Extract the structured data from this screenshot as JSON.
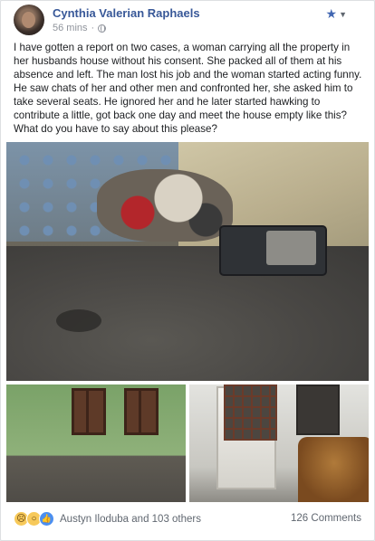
{
  "post": {
    "author": "Cynthia Valerian Raphaels",
    "time": "56 mins",
    "separator": "·",
    "body": "I have gotten a report on two cases, a woman carrying all the property in her husbands house without his consent. She packed all of them at his absence and left. The man lost his job and the woman started acting funny. He saw chats of her and other men and confronted her, she asked him to take several seats. He ignored her and he later started hawking to contribute a little, got back one day and meet the house empty like this? What do you have to say about this please?"
  },
  "actions": {
    "star_icon": "star-icon",
    "chevron_icon": "chevron-down-icon"
  },
  "photos": [
    {
      "name": "room-with-suitcase-photo"
    },
    {
      "name": "green-room-photo"
    },
    {
      "name": "sofa-room-photo"
    }
  ],
  "reactions": {
    "icons": [
      "sad",
      "wow",
      "like"
    ],
    "summary": "Austyn Iloduba and 103 others",
    "comments": "126 Comments"
  },
  "colors": {
    "author_link": "#385898",
    "meta": "#90949c",
    "like_blue": "#4c8ff0"
  }
}
